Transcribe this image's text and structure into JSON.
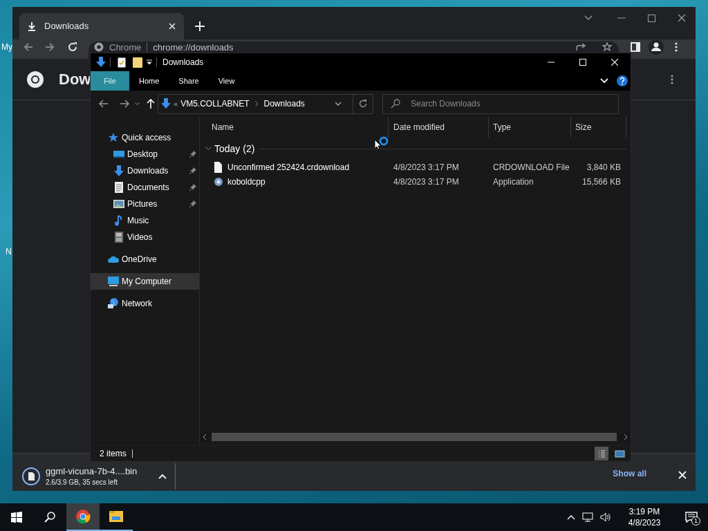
{
  "desktop": {
    "icon_labels": [
      "My",
      "N"
    ]
  },
  "browser": {
    "tabs": [
      {
        "label": "Downloads",
        "selected": true
      }
    ],
    "omnibox": {
      "site": "Chrome",
      "url": "chrome://downloads"
    },
    "page_title": "Dow",
    "download": {
      "file": "ggml-vicuna-7b-4....bin",
      "status": "2.6/3.9 GB, 35 secs left",
      "show_all": "Show all"
    }
  },
  "explorer": {
    "title": "Downloads",
    "ribbon_tabs": [
      {
        "label": "File",
        "selected": true
      },
      {
        "label": "Home",
        "selected": false
      },
      {
        "label": "Share",
        "selected": false
      },
      {
        "label": "View",
        "selected": false
      }
    ],
    "breadcrumb_overflow": "«",
    "breadcrumb": [
      "VM5.COLLABNET",
      "Downloads"
    ],
    "search": {
      "placeholder": "Search Downloads"
    },
    "nav": [
      {
        "label": "Quick access",
        "kind": "star",
        "selected": false,
        "children": [
          {
            "label": "Desktop",
            "kind": "desktop",
            "pinned": true,
            "selected": false
          },
          {
            "label": "Downloads",
            "kind": "download",
            "pinned": true,
            "selected": false
          },
          {
            "label": "Documents",
            "kind": "document",
            "pinned": true,
            "selected": false
          },
          {
            "label": "Pictures",
            "kind": "pictures",
            "pinned": true,
            "selected": false
          },
          {
            "label": "Music",
            "kind": "music",
            "pinned": false,
            "selected": false
          },
          {
            "label": "Videos",
            "kind": "videos",
            "pinned": false,
            "selected": false
          }
        ]
      },
      {
        "label": "OneDrive",
        "kind": "cloud",
        "selected": false
      },
      {
        "label": "My Computer",
        "kind": "computer",
        "selected": true
      },
      {
        "label": "Network",
        "kind": "network",
        "selected": false
      }
    ],
    "columns": [
      "Name",
      "Date modified",
      "Type",
      "Size"
    ],
    "group": {
      "label": "Today (2)",
      "expanded": true
    },
    "rows": [
      {
        "kind": "file",
        "name": "Unconfirmed 252424.crdownload",
        "date": "4/8/2023 3:17 PM",
        "type": "CRDOWNLOAD File",
        "size": "3,840 KB"
      },
      {
        "kind": "app",
        "name": "koboldcpp",
        "date": "4/8/2023 3:17 PM",
        "type": "Application",
        "size": "15,566 KB"
      }
    ],
    "status": "2 items",
    "view_buttons": [
      {
        "kind": "details",
        "selected": true
      },
      {
        "kind": "tiles",
        "selected": false
      }
    ]
  },
  "taskbar": {
    "apps": [
      {
        "kind": "chrome",
        "selected": true
      },
      {
        "kind": "explorer",
        "selected": false
      }
    ],
    "time": "3:19 PM",
    "date": "4/8/2023",
    "notifications": "1"
  }
}
